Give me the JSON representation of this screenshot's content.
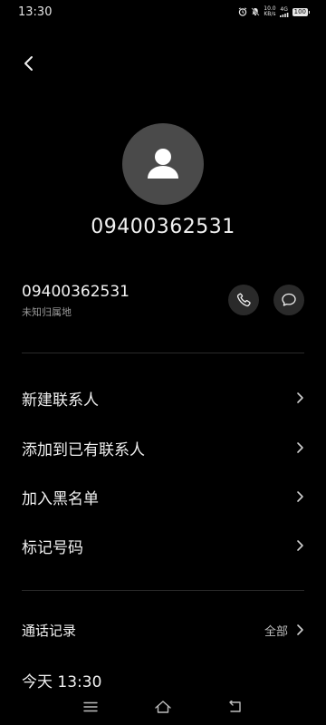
{
  "status_bar": {
    "time": "13:30",
    "net_speed_value": "10.0",
    "net_speed_unit": "KB/s",
    "network": "4G",
    "battery": "100",
    "icons": [
      "alarm-icon",
      "mute-icon",
      "signal-icon",
      "battery-icon"
    ]
  },
  "header": {
    "back_icon": "chevron-left-icon",
    "avatar_icon": "person-icon",
    "number": "09400362531"
  },
  "number_row": {
    "number": "09400362531",
    "location": "未知归属地",
    "call_icon": "phone-icon",
    "message_icon": "message-icon"
  },
  "menu": [
    {
      "label": "新建联系人"
    },
    {
      "label": "添加到已有联系人"
    },
    {
      "label": "加入黑名单"
    },
    {
      "label": "标记号码"
    }
  ],
  "call_log": {
    "title": "通话记录",
    "all_label": "全部",
    "entries": [
      {
        "text": "今天 13:30"
      }
    ]
  },
  "colors": {
    "background": "#000000",
    "text": "#f0f0f0",
    "muted": "#9a9a9a",
    "avatar_bg": "#4a4a4a",
    "button_bg": "#2a2a2a"
  }
}
